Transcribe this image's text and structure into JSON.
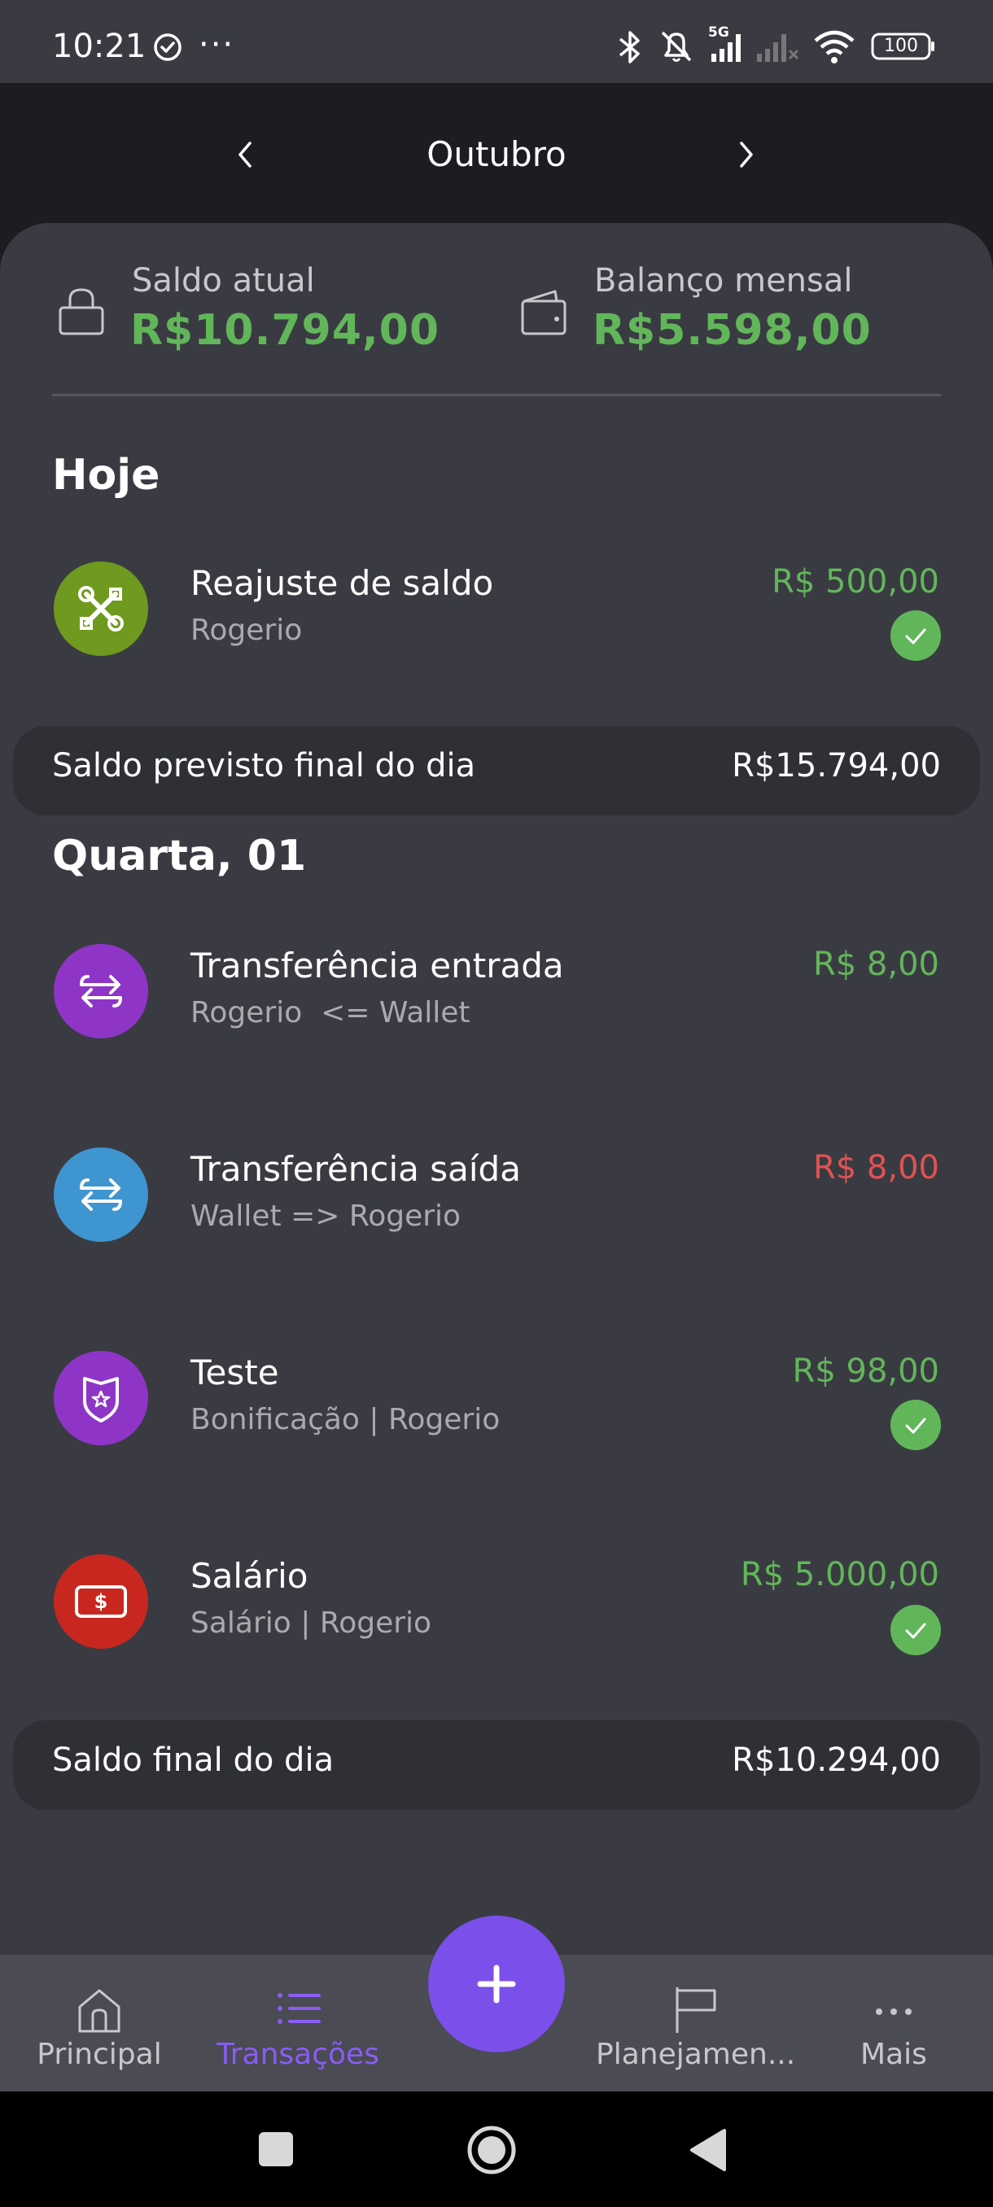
{
  "status_bar": {
    "time": "10:21",
    "network": "5G",
    "battery": "100"
  },
  "header": {
    "month": "Outubro"
  },
  "balance": {
    "current_label": "Saldo atual",
    "current_value": "R$10.794,00",
    "monthly_label": "Balanço mensal",
    "monthly_value": "R$5.598,00"
  },
  "sections": [
    {
      "title": "Hoje",
      "transactions": [
        {
          "title": "Reajuste de saldo",
          "subtitle": "Rogerio",
          "amount": "R$ 500,00",
          "kind": "income",
          "confirmed": true,
          "icon": "tools-icon",
          "icon_color": "#6f9a1f"
        }
      ],
      "summary_label": "Saldo previsto final do dia",
      "summary_value": "R$15.794,00"
    },
    {
      "title": "Quarta, 01",
      "transactions": [
        {
          "title": "Transferência entrada",
          "subtitle": "Rogerio  <= Wallet",
          "amount": "R$ 8,00",
          "kind": "income",
          "confirmed": false,
          "icon": "transfer-icon",
          "icon_color": "#8e35c7"
        },
        {
          "title": "Transferência saída",
          "subtitle": "Wallet => Rogerio",
          "amount": "R$ 8,00",
          "kind": "expense",
          "confirmed": false,
          "icon": "transfer-icon",
          "icon_color": "#3f95cf"
        },
        {
          "title": "Teste",
          "subtitle": "Bonificação | Rogerio",
          "amount": "R$ 98,00",
          "kind": "income",
          "confirmed": true,
          "icon": "badge-star-icon",
          "icon_color": "#8e35c7"
        },
        {
          "title": "Salário",
          "subtitle": "Salário | Rogerio",
          "amount": "R$ 5.000,00",
          "kind": "income",
          "confirmed": true,
          "icon": "cash-icon",
          "icon_color": "#c7271f"
        }
      ],
      "summary_label": "Saldo final do dia",
      "summary_value": "R$10.294,00"
    }
  ],
  "bottom_nav": [
    {
      "label": "Principal",
      "icon": "home-icon",
      "active": false
    },
    {
      "label": "Transações",
      "icon": "list-icon",
      "active": true
    },
    {
      "label": "Planejamen...",
      "icon": "flag-icon",
      "active": false
    },
    {
      "label": "Mais",
      "icon": "more-icon",
      "active": false
    }
  ],
  "colors": {
    "income": "#62b65a",
    "expense": "#e05252",
    "accent": "#7b4fea",
    "panel": "#3a3b42"
  }
}
